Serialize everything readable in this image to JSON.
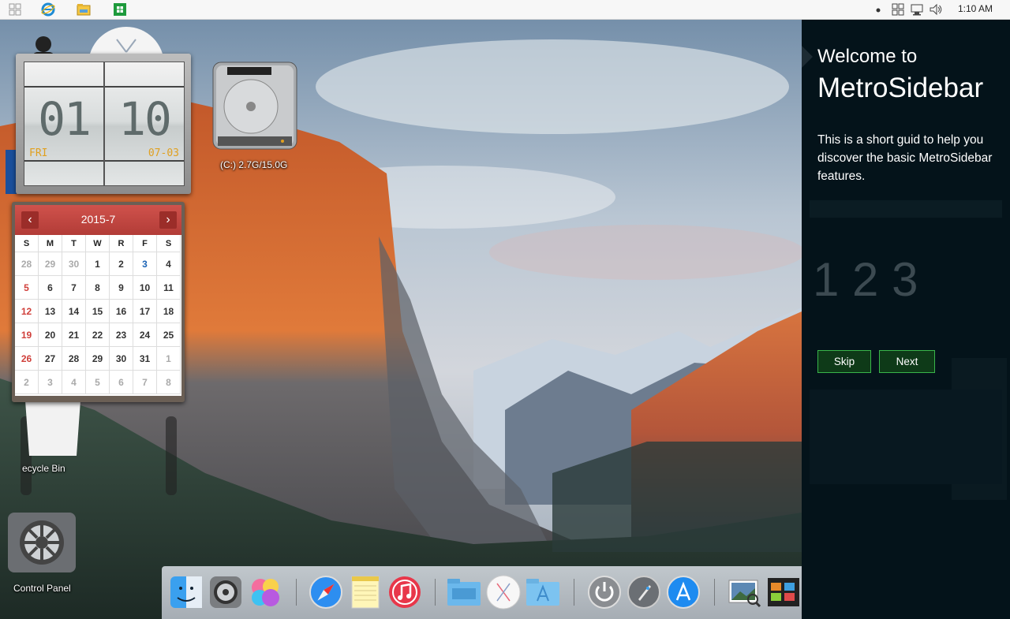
{
  "taskbar": {
    "time": "1:10 AM",
    "left_icons": [
      "start-icon",
      "ie-icon",
      "explorer-icon",
      "store-icon"
    ],
    "tray_icons": [
      "dot-icon",
      "windows-icon",
      "network-icon",
      "volume-icon"
    ]
  },
  "desktop": {
    "drive_label": "(C:)  2.7G/15.0G",
    "recycle_bin_label": "ecycle Bin",
    "control_panel_label": "Control Panel"
  },
  "clock": {
    "hour": "01",
    "minute": "10",
    "day": "FRI",
    "date": "07-03"
  },
  "calendar": {
    "title": "2015-7",
    "prev_label": "‹",
    "next_label": "›",
    "weekdays": [
      "S",
      "M",
      "T",
      "W",
      "R",
      "F",
      "S"
    ],
    "weeks": [
      [
        "28",
        "29",
        "30",
        "1",
        "2",
        "3",
        "4"
      ],
      [
        "5",
        "6",
        "7",
        "8",
        "9",
        "10",
        "11"
      ],
      [
        "12",
        "13",
        "14",
        "15",
        "16",
        "17",
        "18"
      ],
      [
        "19",
        "20",
        "21",
        "22",
        "23",
        "24",
        "25"
      ],
      [
        "26",
        "27",
        "28",
        "29",
        "30",
        "31",
        "1"
      ],
      [
        "2",
        "3",
        "4",
        "5",
        "6",
        "7",
        "8"
      ]
    ]
  },
  "sidebar": {
    "welcome": "Welcome to",
    "title": "MetroSidebar",
    "description": "This is a short guid to help you discover the basic MetroSidebar features.",
    "digits": "1 2 3",
    "skip_label": "Skip",
    "next_label": "Next"
  },
  "dock": {
    "items": [
      "finder-icon",
      "system-preferences-icon",
      "game-center-icon",
      "safari-icon",
      "notes-icon",
      "itunes-icon",
      "folder-icon",
      "osx-icon",
      "applications-folder-icon",
      "power-icon",
      "launchpad-icon",
      "app-store-icon",
      "preview-icon",
      "photo-booth-icon",
      "trash-icon"
    ]
  },
  "colors": {
    "sidebar_bg": "#04131a",
    "button_border": "#39b54a",
    "calendar_header": "#c0433e"
  }
}
